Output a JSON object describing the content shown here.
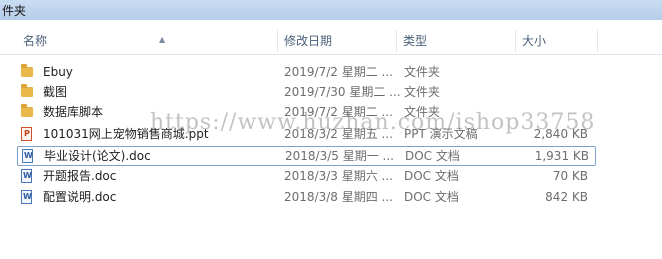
{
  "window": {
    "title": "件夹"
  },
  "columns": {
    "name": "名称",
    "date": "修改日期",
    "type": "类型",
    "size": "大小"
  },
  "files": [
    {
      "name": "Ebuy",
      "date": "2019/7/2 星期二 ...",
      "type": "文件夹",
      "size": "",
      "icon": "folder-icon"
    },
    {
      "name": "截图",
      "date": "2019/7/30 星期二 ...",
      "type": "文件夹",
      "size": "",
      "icon": "folder-icon"
    },
    {
      "name": "数据库脚本",
      "date": "2019/7/2 星期二 ...",
      "type": "文件夹",
      "size": "",
      "icon": "folder-icon"
    },
    {
      "name": "101031网上宠物销售商城.ppt",
      "date": "2018/3/2 星期五 ...",
      "type": "PPT 演示文稿",
      "size": "2,840 KB",
      "icon": "ppt-icon"
    },
    {
      "name": "毕业设计(论文).doc",
      "date": "2018/3/5 星期一 ...",
      "type": "DOC 文档",
      "size": "1,931 KB",
      "icon": "doc-icon"
    },
    {
      "name": "开题报告.doc",
      "date": "2018/3/3 星期六 ...",
      "type": "DOC 文档",
      "size": "70 KB",
      "icon": "doc-icon"
    },
    {
      "name": "配置说明.doc",
      "date": "2018/3/8 星期四 ...",
      "type": "DOC 文档",
      "size": "842 KB",
      "icon": "doc-icon"
    }
  ],
  "watermark": "https://www.huzhan.com/ishop33758"
}
